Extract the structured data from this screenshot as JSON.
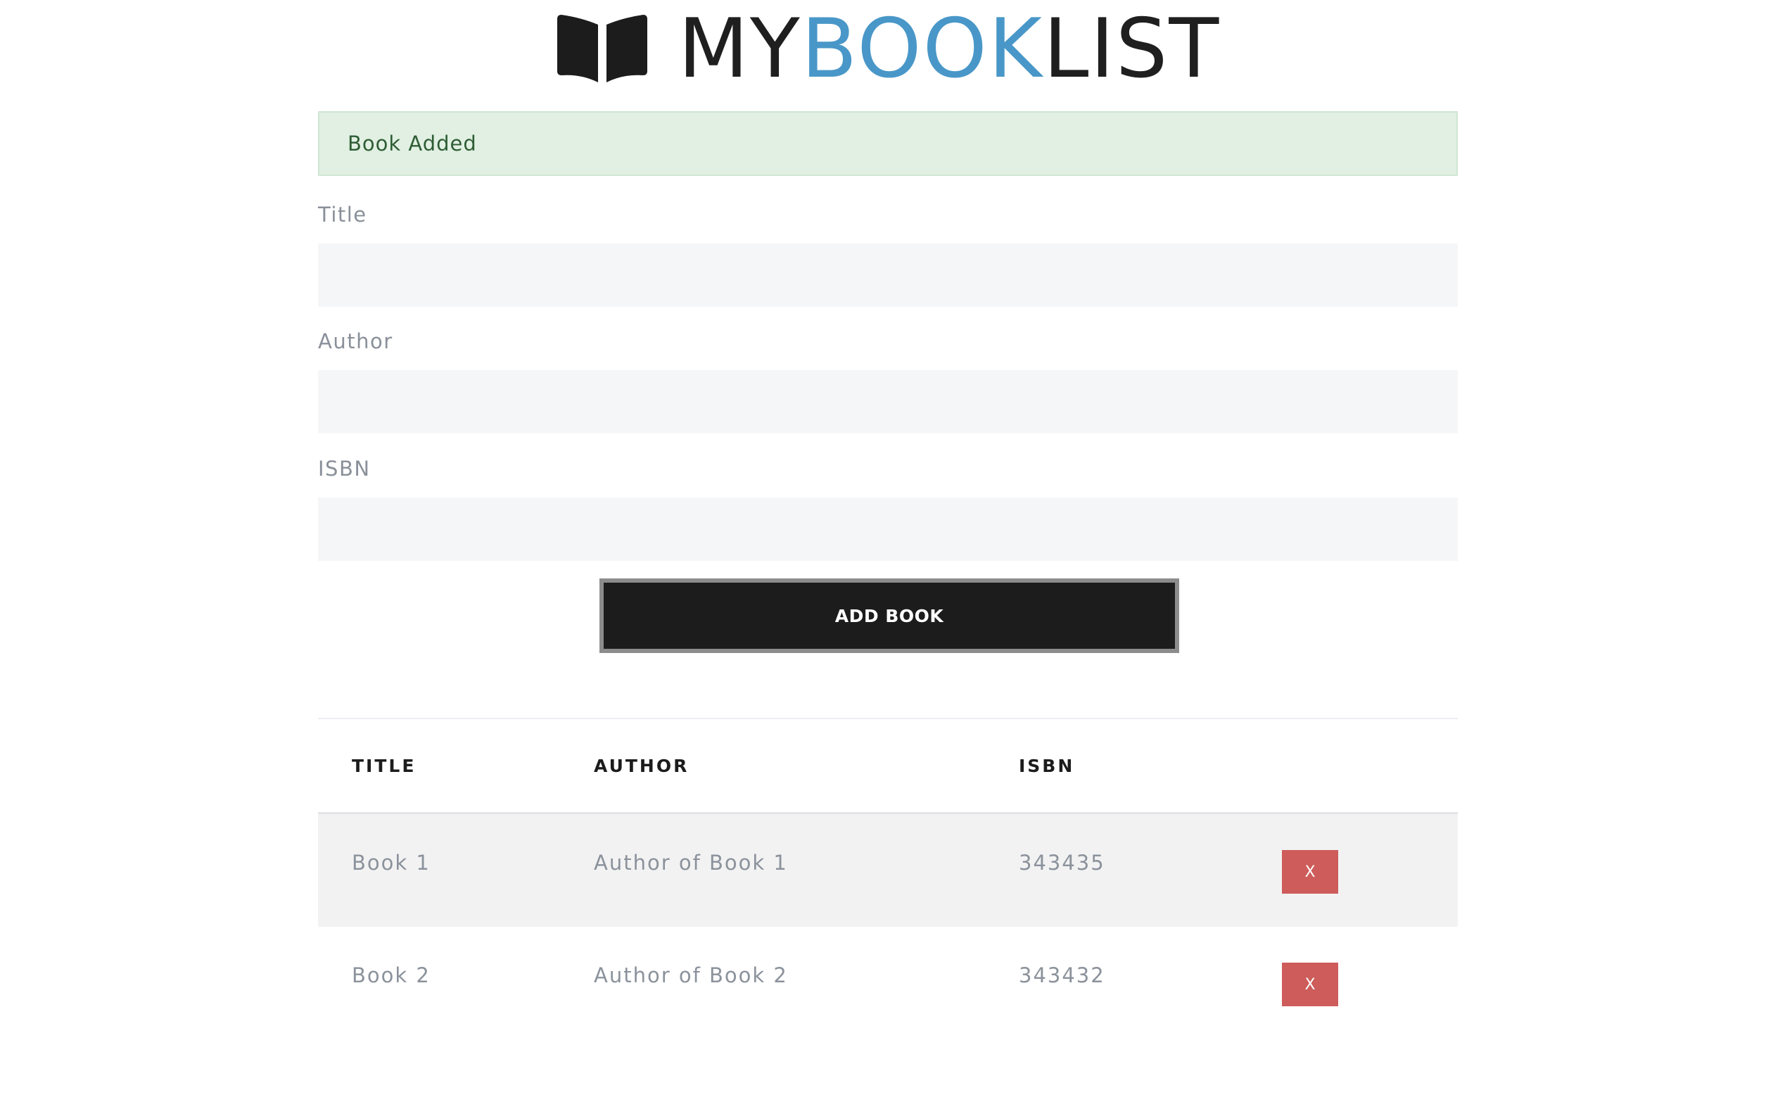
{
  "brand": {
    "part1": "MY",
    "part2": "BOOK",
    "part3": "LIST",
    "icon": "open-book-icon",
    "accent_color": "#4997c8"
  },
  "alert": {
    "message": "Book Added",
    "type": "success",
    "color": "#e1f0e3"
  },
  "form": {
    "title": {
      "label": "Title",
      "value": "",
      "placeholder": ""
    },
    "author": {
      "label": "Author",
      "value": "",
      "placeholder": ""
    },
    "isbn": {
      "label": "ISBN",
      "value": "",
      "placeholder": ""
    },
    "submit_label": "ADD BOOK"
  },
  "table": {
    "headers": [
      "TITLE",
      "AUTHOR",
      "ISBN"
    ],
    "rows": [
      {
        "title": "Book 1",
        "author": "Author of Book 1",
        "isbn": "343435",
        "delete_label": "X"
      },
      {
        "title": "Book 2",
        "author": "Author of Book 2",
        "isbn": "343432",
        "delete_label": "X"
      }
    ],
    "delete_color": "#cd5c5a"
  }
}
